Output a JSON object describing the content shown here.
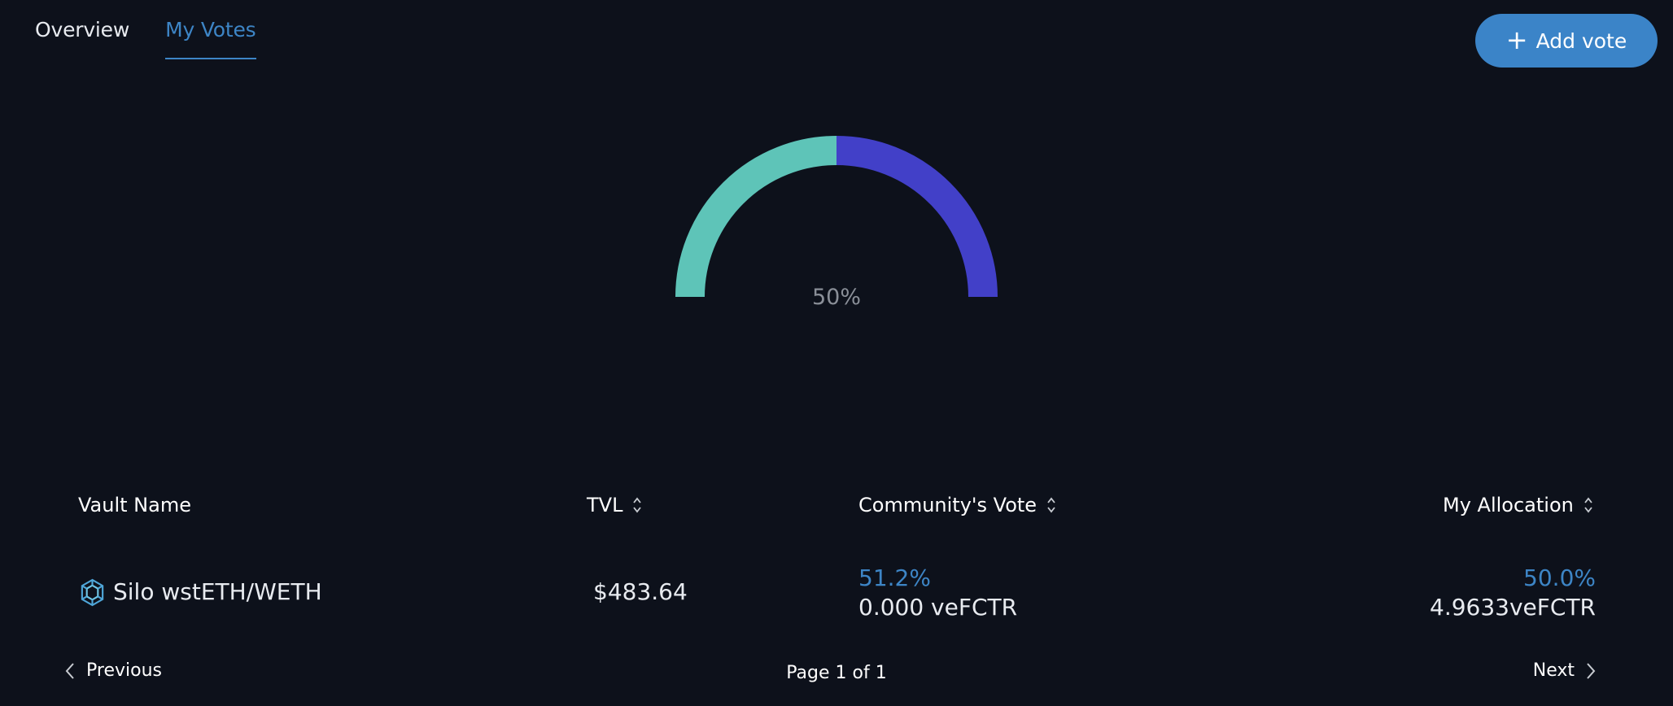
{
  "tabs": [
    {
      "label": "Overview",
      "active": false
    },
    {
      "label": "My Votes",
      "active": true
    }
  ],
  "add_vote_button": {
    "label": "Add vote",
    "icon": "plus-icon"
  },
  "gauge": {
    "center_label": "50%",
    "segments": [
      {
        "name": "Silo wstETH/WETH",
        "value": 50,
        "color": "#5ec4b8"
      },
      {
        "name": "remaining",
        "value": 50,
        "color": "#4240c8"
      }
    ]
  },
  "table": {
    "columns": [
      {
        "label": "Vault Name",
        "sortable": false
      },
      {
        "label": "TVL",
        "sortable": true
      },
      {
        "label": "Community's Vote",
        "sortable": true
      },
      {
        "label": "My Allocation",
        "sortable": true
      }
    ],
    "rows": [
      {
        "vault_name": "Silo wstETH/WETH",
        "vault_icon": "silo-vault-icon",
        "tvl": "$483.64",
        "community_vote_pct": "51.2%",
        "community_vote_amount": "0.000 veFCTR",
        "my_allocation_pct": "50.0%",
        "my_allocation_amount": "4.9633veFCTR"
      }
    ]
  },
  "pagination": {
    "previous_label": "Previous",
    "next_label": "Next",
    "page_info": "Page 1 of 1"
  },
  "colors": {
    "background": "#0d111b",
    "accent": "#3d85c6",
    "gauge_teal": "#5ec4b8",
    "gauge_indigo": "#4240c8"
  }
}
